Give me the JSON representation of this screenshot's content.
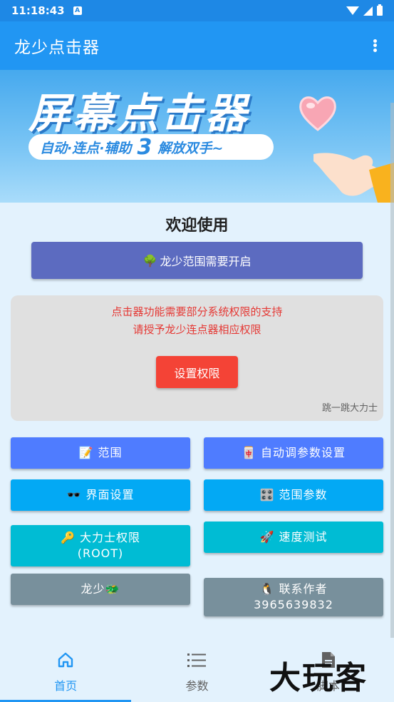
{
  "status_bar": {
    "time": "11:18:43",
    "badge": "A"
  },
  "app_bar": {
    "title": "龙少点击器"
  },
  "banner": {
    "title": "屏幕点击器",
    "pill_left": "自动·连点·辅助",
    "pill_number": "3",
    "pill_right": "解放双手~"
  },
  "welcome": "欢迎使用",
  "range_button": {
    "icon": "🌳",
    "label": "龙少范围需要开启"
  },
  "permission_card": {
    "line1": "点击器功能需要部分系统权限的支持",
    "line2": "请授予龙少连点器相应权限",
    "button": "设置权限",
    "footer": "跳一跳大力士"
  },
  "buttons": {
    "range": {
      "icon": "📝",
      "label": "范围"
    },
    "auto_params": {
      "icon": "🀄",
      "label": "自动调参数设置"
    },
    "ui_settings": {
      "icon": "🕶️",
      "label": "界面设置"
    },
    "range_params": {
      "icon": "🎛️",
      "label": "范围参数"
    },
    "root": {
      "icon": "🔑",
      "label": "大力士权限",
      "sub": "(ROOT)"
    },
    "speed_test": {
      "icon": "🚀",
      "label": "速度测试"
    },
    "longshao": {
      "label": "龙少",
      "icon": "🐲"
    },
    "contact": {
      "icon": "🐧",
      "label": "联系作者",
      "sub": "3965639832"
    }
  },
  "colors": {
    "primary": "#2196f3",
    "status_bar": "#1e88e5",
    "indigo": "#5c6bc0",
    "red": "#f44336",
    "blue_btn": "#4f7cff",
    "light_blue_btn": "#03a9f4",
    "cyan_btn": "#00bcd4",
    "grey_btn": "#78909c"
  },
  "bottom_nav": {
    "items": [
      {
        "label": "首页",
        "icon": "home-icon",
        "active": true
      },
      {
        "label": "参数",
        "icon": "list-icon",
        "active": false
      },
      {
        "label": "脚本",
        "icon": "document-icon",
        "active": false
      }
    ]
  },
  "watermark": "大玩客"
}
